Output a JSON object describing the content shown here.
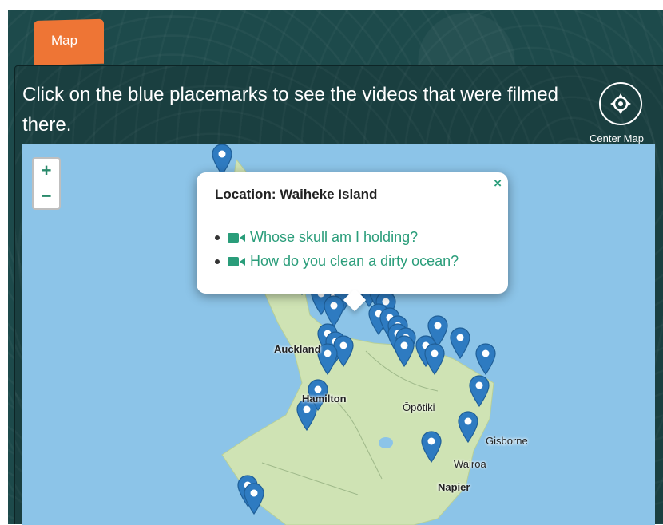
{
  "tab": {
    "label": "Map"
  },
  "instructions": "Click on the blue placemarks to see the videos that were filmed there.",
  "center_map": {
    "label": "Center Map"
  },
  "zoom": {
    "in": "+",
    "out": "−"
  },
  "popup": {
    "close": "×",
    "title": "Location: Waiheke Island",
    "videos": [
      "Whose skull am I holding?",
      "How do you clean a dirty ocean?"
    ]
  },
  "places": [
    "Auckland",
    "Hamilton",
    "Ōpōtiki",
    "Gisborne",
    "Wairoa",
    "Napier"
  ],
  "colors": {
    "accent": "#ee7535",
    "link": "#2a9d7a",
    "pin": "#2e7bc1",
    "sea": "#8cc4e8",
    "land": "#cfe3b4"
  }
}
